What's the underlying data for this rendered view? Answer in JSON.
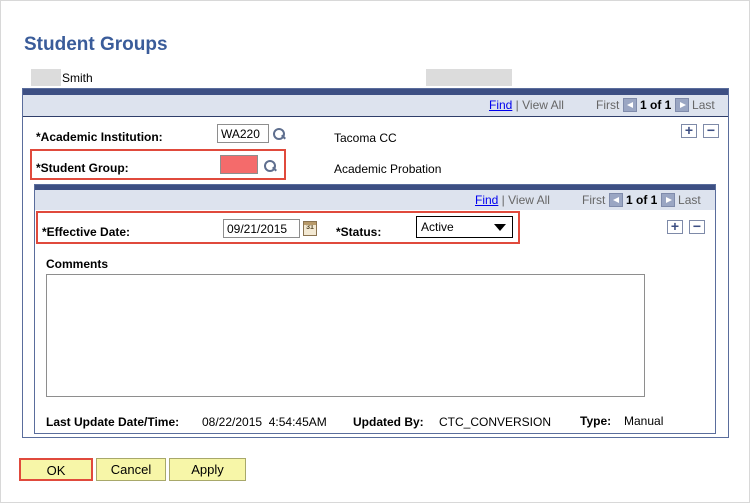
{
  "page": {
    "title": "Student Groups"
  },
  "student": {
    "name": "Smith"
  },
  "outer_nav": {
    "find": "Find",
    "sep": " | ",
    "view_all": "View All",
    "first": "First",
    "count": "1 of 1",
    "last": "Last"
  },
  "fields": {
    "academic_institution": {
      "label": "*Academic Institution:",
      "value": "WA220",
      "description": "Tacoma CC"
    },
    "student_group": {
      "label": "*Student Group:",
      "value": "",
      "description": "Academic Probation"
    }
  },
  "inner_nav": {
    "find": "Find",
    "sep": " | ",
    "view_all": "View All",
    "first": "First",
    "count": "1 of 1",
    "last": "Last"
  },
  "effective": {
    "date_label": "*Effective Date:",
    "date_value": "09/21/2015",
    "status_label": "*Status:",
    "status_value": "Active",
    "calendar_glyph": "31"
  },
  "comments": {
    "label": "Comments",
    "value": ""
  },
  "audit": {
    "last_update_label": "Last Update Date/Time:",
    "last_update_value": "08/22/2015  4:54:45AM",
    "updated_by_label": "Updated By:",
    "updated_by_value": "CTC_CONVERSION",
    "type_label": "Type:",
    "type_value": "Manual"
  },
  "buttons": {
    "ok": "OK",
    "cancel": "Cancel",
    "apply": "Apply"
  },
  "row_controls": {
    "add": "+",
    "delete": "−"
  },
  "colors": {
    "title": "#3a5c9a",
    "header_bar": "#3d4f83",
    "highlight": "#e04a3c",
    "required_empty": "#f46b6b",
    "button_bg": "#f7f6a8"
  }
}
